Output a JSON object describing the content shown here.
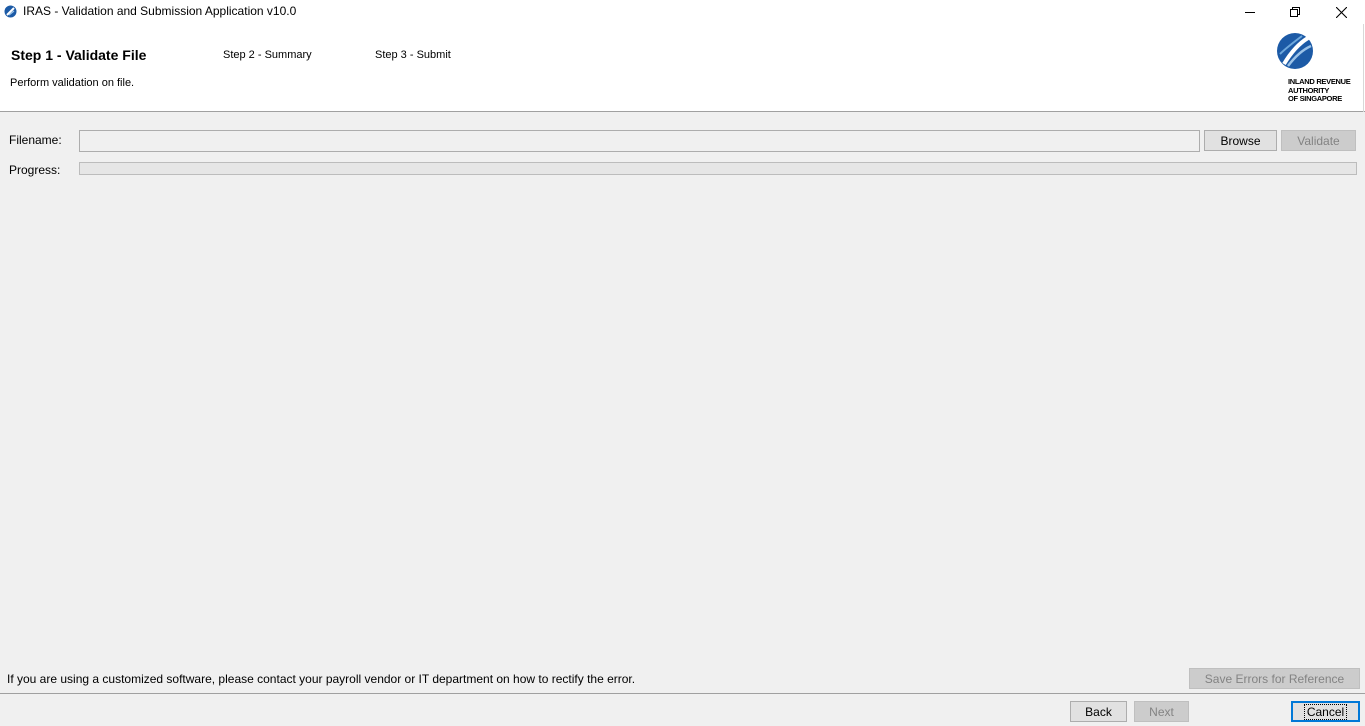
{
  "window": {
    "title": "IRAS - Validation and Submission Application v10.0",
    "icons": [
      "app-icon",
      "minimize-icon",
      "maximize-icon",
      "close-icon"
    ]
  },
  "header": {
    "steps": [
      {
        "label": "Step 1 - Validate File",
        "active": true
      },
      {
        "label": "Step 2 - Summary",
        "active": false
      },
      {
        "label": "Step 3 - Submit",
        "active": false
      }
    ],
    "description": "Perform validation on file.",
    "logo": {
      "lines": [
        "INLAND REVENUE",
        "AUTHORITY",
        "OF SINGAPORE"
      ],
      "colors": {
        "primary": "#1c5aa6",
        "secondary": "#6ea8dc"
      }
    }
  },
  "form": {
    "filename_label": "Filename:",
    "filename_value": "",
    "browse_label": "Browse",
    "validate_label": "Validate",
    "progress_label": "Progress:",
    "progress_value": 0
  },
  "footer": {
    "info": "If you are using a customized software, please contact your payroll vendor or IT department on how to rectify the error.",
    "save_errors_label": "Save Errors for Reference",
    "back_label": "Back",
    "next_label": "Next",
    "cancel_label": "Cancel"
  }
}
